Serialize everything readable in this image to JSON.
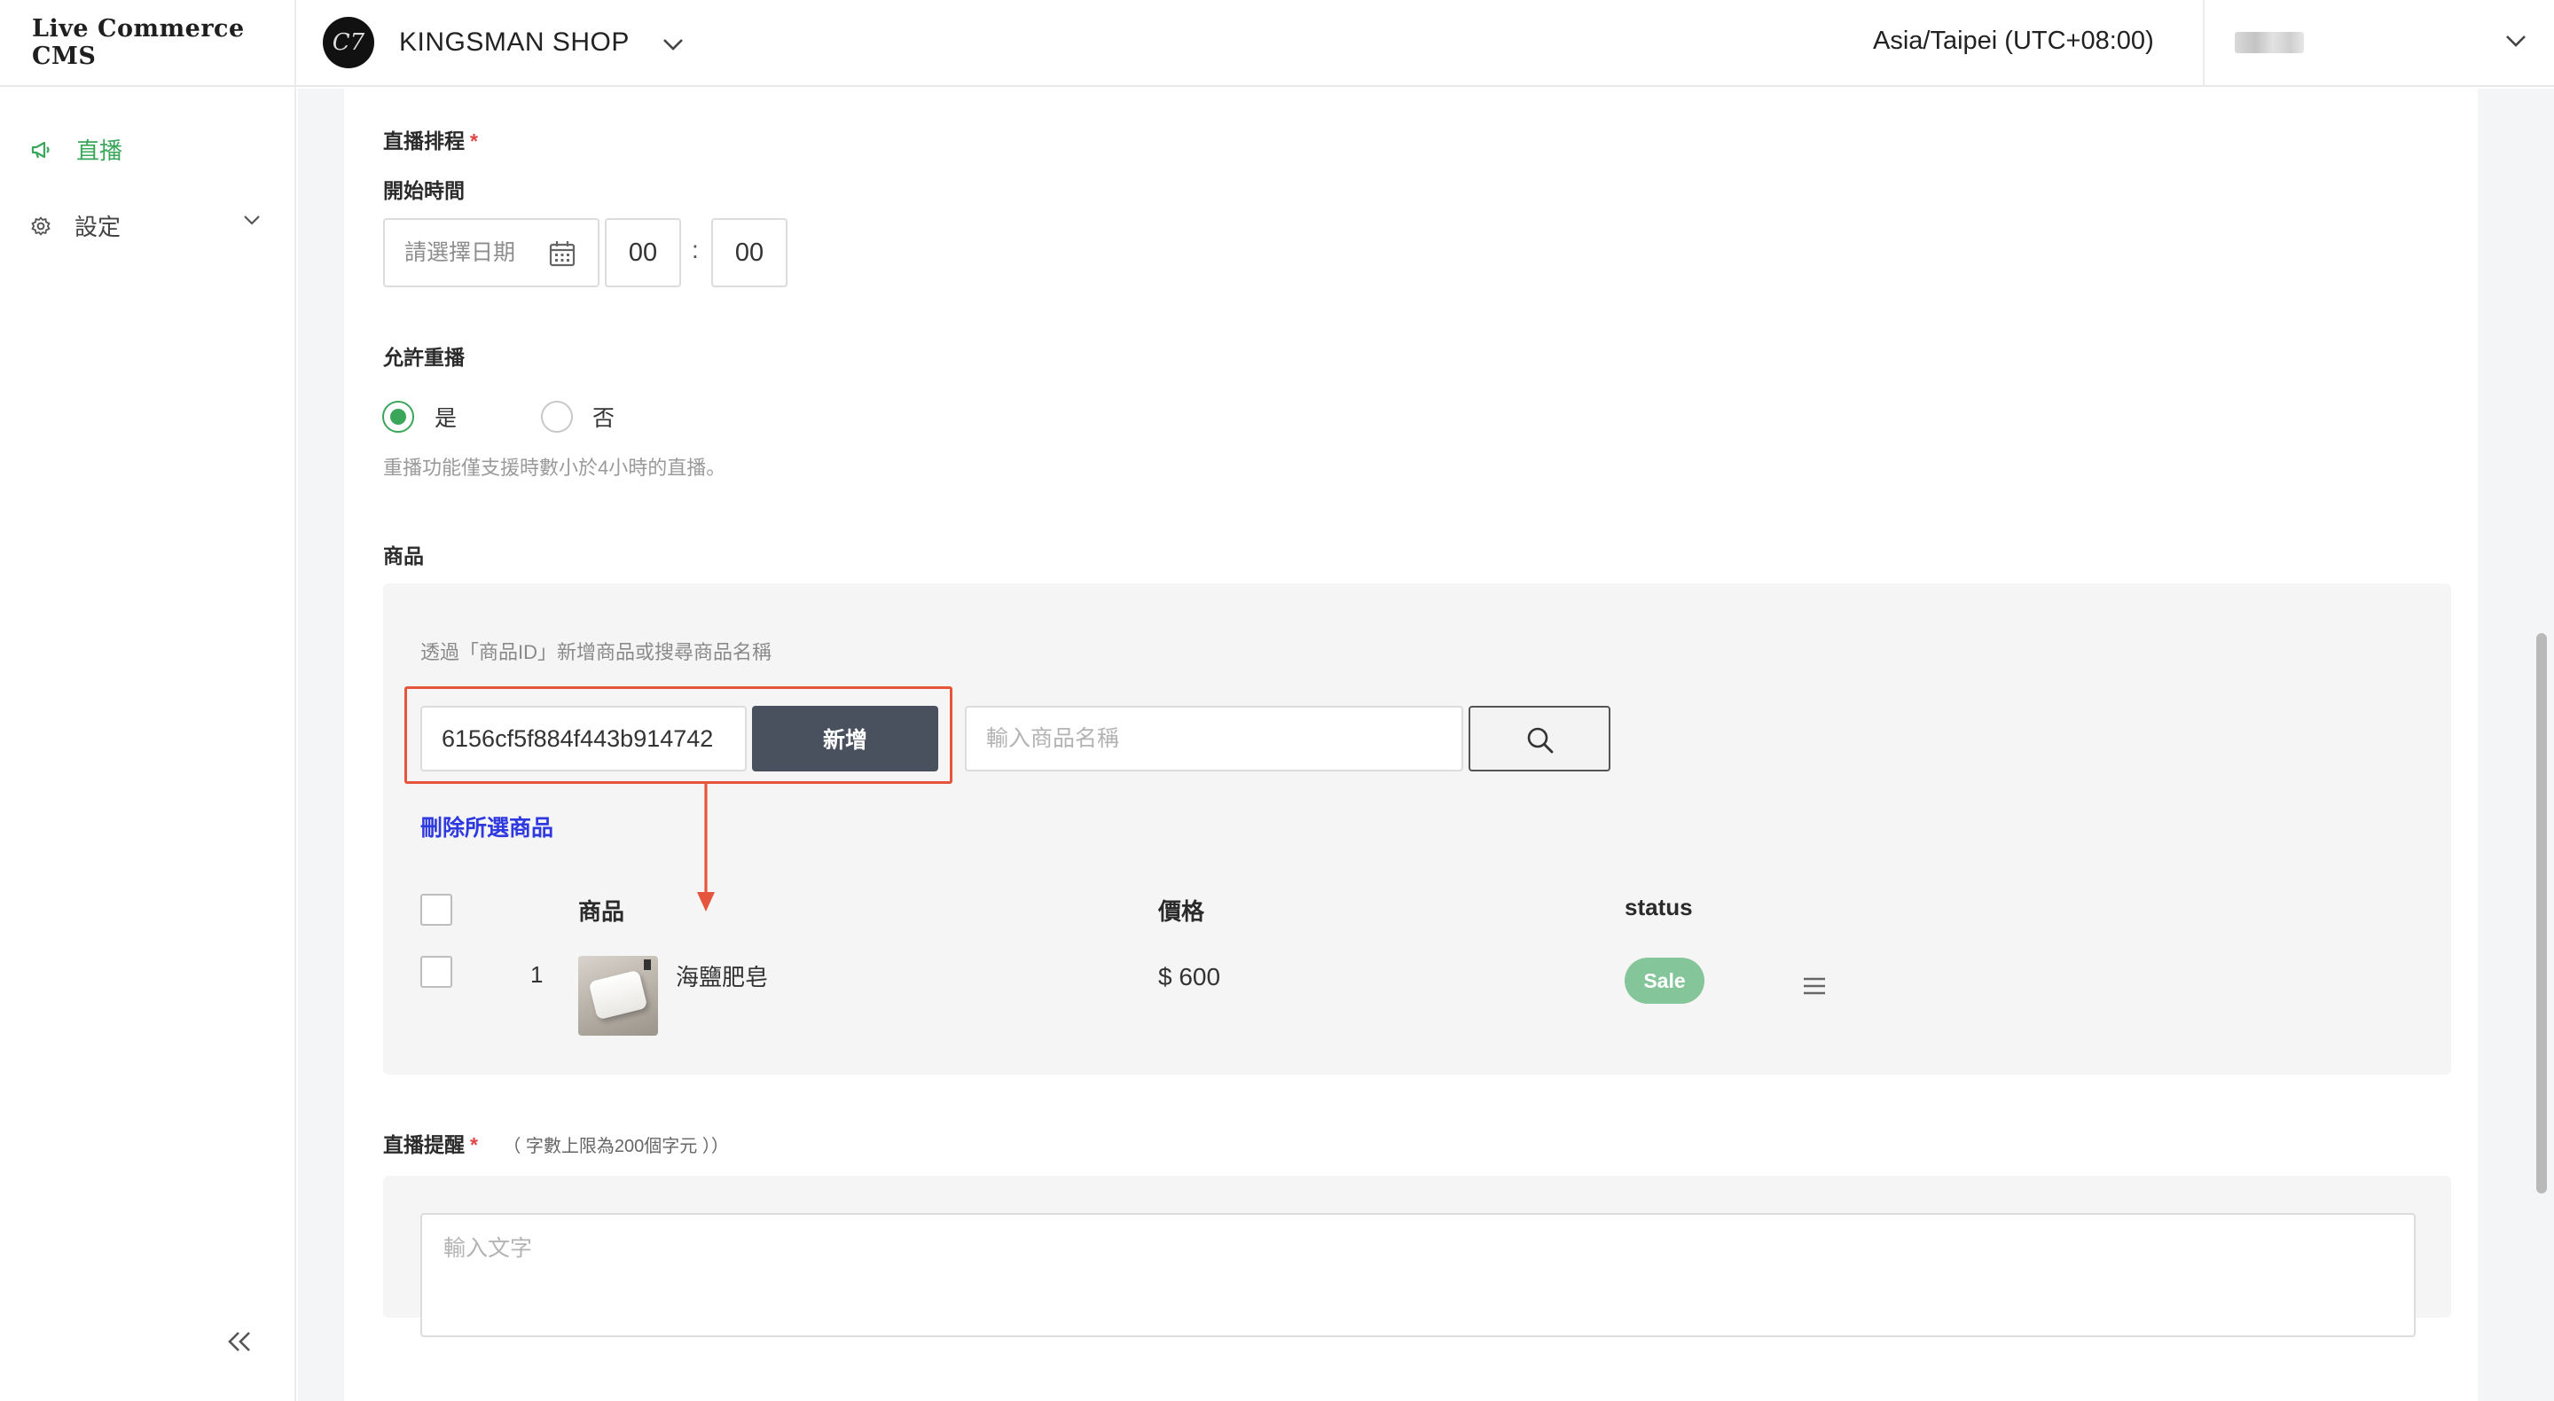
{
  "header": {
    "app_title": "Live Commerce CMS",
    "shop_logo_text": "C7",
    "shop_name": "KINGSMAN SHOP",
    "timezone": "Asia/Taipei (UTC+08:00)"
  },
  "sidebar": {
    "items": [
      {
        "label": "直播",
        "icon": "megaphone-icon",
        "active": true
      },
      {
        "label": "設定",
        "icon": "gear-icon",
        "active": false
      }
    ],
    "accent_color": "#3aa65a"
  },
  "form": {
    "schedule": {
      "label": "直播排程",
      "required_mark": "*",
      "start_label": "開始時間",
      "date_placeholder": "請選擇日期",
      "hour": "00",
      "time_separator": ":",
      "minute": "00"
    },
    "replay": {
      "label": "允許重播",
      "options": [
        {
          "label": "是",
          "selected": true
        },
        {
          "label": "否",
          "selected": false
        }
      ],
      "hint": "重播功能僅支援時數小於4小時的直播。"
    },
    "products": {
      "label": "商品",
      "instruction": "透過「商品ID」新增商品或搜尋商品名稱",
      "id_input_value": "6156cf5f884f443b914742",
      "add_button": "新增",
      "name_placeholder": "輸入商品名稱",
      "delete_selected": "刪除所選商品",
      "columns": {
        "product": "商品",
        "price": "價格",
        "status": "status"
      },
      "rows": [
        {
          "index": "1",
          "name": "海鹽肥皂",
          "price": "$ 600",
          "status": "Sale"
        }
      ]
    },
    "reminder": {
      "label": "直播提醒",
      "required_mark": "*",
      "limit_note": "（ 字數上限為200個字元 ））",
      "placeholder": "輸入文字"
    }
  }
}
